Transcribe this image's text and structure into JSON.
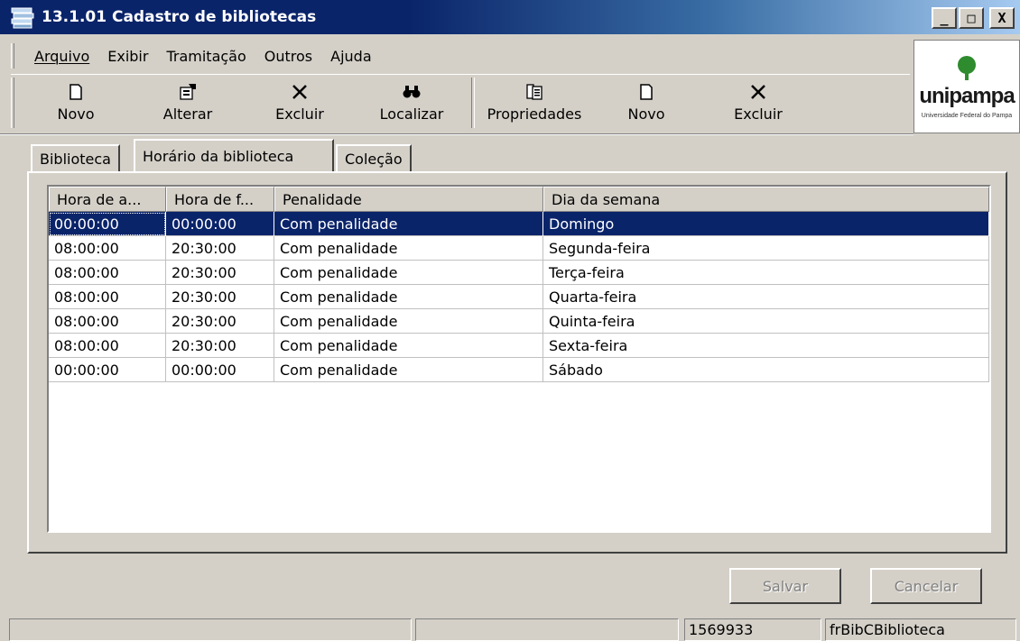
{
  "window": {
    "title": "13.1.01 Cadastro de bibliotecas",
    "title_bar_color": "#0a246a",
    "controls": {
      "minimize": "_",
      "maximize": "□",
      "close": "X"
    }
  },
  "menu": [
    {
      "label": "Arquivo"
    },
    {
      "label": "Exibir"
    },
    {
      "label": "Tramitação"
    },
    {
      "label": "Outros"
    },
    {
      "label": "Ajuda"
    }
  ],
  "toolbar": {
    "buttons": [
      {
        "label": "Novo",
        "icon": "new-document-icon"
      },
      {
        "label": "Alterar",
        "icon": "edit-icon"
      },
      {
        "label": "Excluir",
        "icon": "delete-x-icon"
      },
      {
        "label": "Localizar",
        "icon": "binoculars-icon"
      },
      {
        "label": "Propriedades",
        "icon": "properties-icon"
      },
      {
        "label": "Novo",
        "icon": "new-document-icon"
      },
      {
        "label": "Excluir",
        "icon": "delete-x-icon"
      }
    ]
  },
  "logo": {
    "brand": "unipampa",
    "subtitle": "Universidade Federal do Pampa",
    "color": "#2e8b2e"
  },
  "tabs": [
    {
      "label": "Biblioteca"
    },
    {
      "label": "Horário da biblioteca",
      "active": true
    },
    {
      "label": "Coleção"
    }
  ],
  "grid": {
    "columns": [
      "Hora de a...",
      "Hora de f...",
      "Penalidade",
      "Dia da semana"
    ],
    "rows": [
      [
        "00:00:00",
        "00:00:00",
        "Com penalidade",
        "Domingo"
      ],
      [
        "08:00:00",
        "20:30:00",
        "Com penalidade",
        "Segunda-feira"
      ],
      [
        "08:00:00",
        "20:30:00",
        "Com penalidade",
        "Terça-feira"
      ],
      [
        "08:00:00",
        "20:30:00",
        "Com penalidade",
        "Quarta-feira"
      ],
      [
        "08:00:00",
        "20:30:00",
        "Com penalidade",
        "Quinta-feira"
      ],
      [
        "08:00:00",
        "20:30:00",
        "Com penalidade",
        "Sexta-feira"
      ],
      [
        "00:00:00",
        "00:00:00",
        "Com penalidade",
        "Sábado"
      ]
    ],
    "selected_row": 0,
    "selection_color": "#0a246a"
  },
  "actions": {
    "save": "Salvar",
    "cancel": "Cancelar"
  },
  "status": {
    "panel1": "",
    "panel2": "",
    "record": "1569933",
    "form": "frBibCBiblioteca"
  }
}
